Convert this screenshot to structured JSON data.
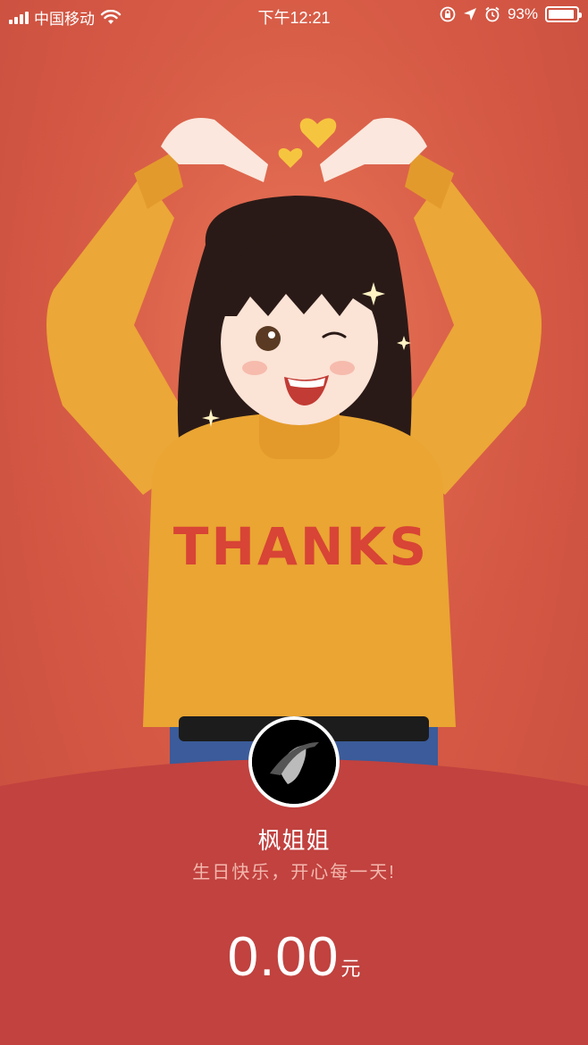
{
  "status_bar": {
    "carrier": "中国移动",
    "time": "下午12:21",
    "battery_percent": "93%",
    "battery_level": 0.93,
    "icons": [
      "signal-icon",
      "wifi-icon",
      "rotation-lock-icon",
      "location-icon",
      "alarm-icon",
      "battery-icon"
    ]
  },
  "illustration": {
    "sweater_text": "THANKS"
  },
  "red_packet": {
    "sender_name": "枫姐姐",
    "wish": "生日快乐，开心每一天!",
    "amount": "0.00",
    "currency_unit": "元"
  },
  "colors": {
    "background": "#d65a45",
    "card": "#c1423f",
    "sweater": "#eaa533",
    "sweater_text": "#d84435"
  }
}
